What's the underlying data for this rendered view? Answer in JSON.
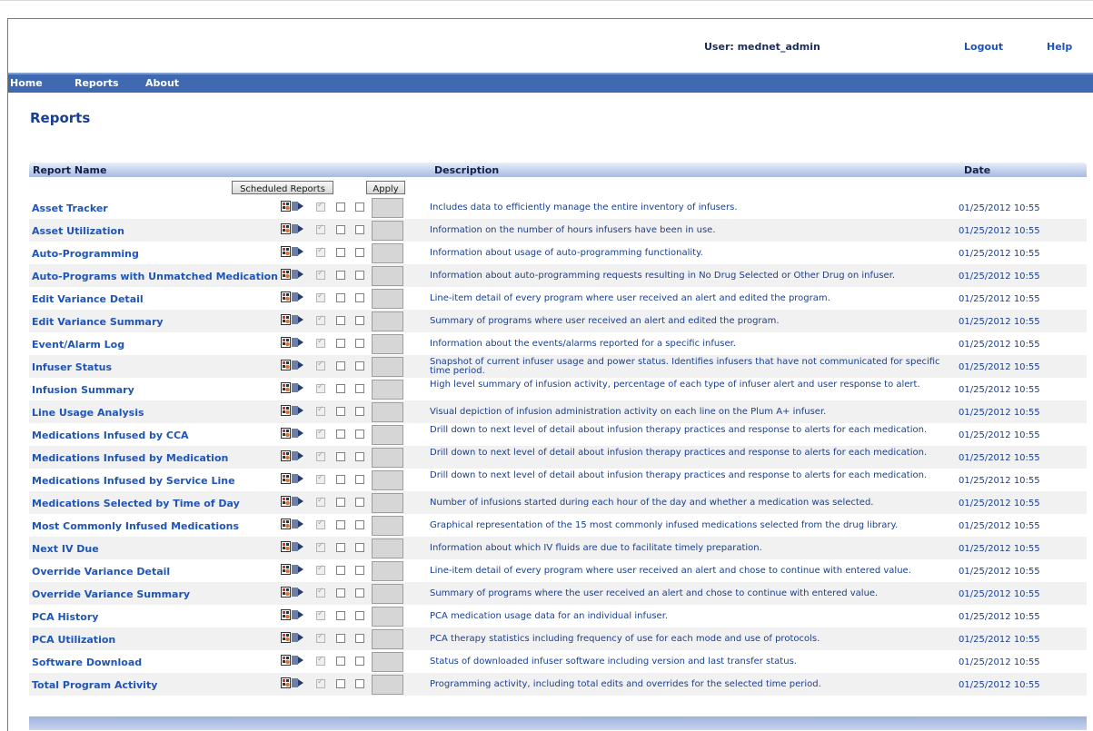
{
  "header": {
    "user_label": "User: mednet_admin",
    "logout": "Logout",
    "help": "Help"
  },
  "nav": {
    "items": [
      "Home",
      "Reports",
      "About"
    ]
  },
  "page": {
    "title": "Reports"
  },
  "table": {
    "columns": {
      "name": "Report Name",
      "description": "Description",
      "date": "Date"
    },
    "scheduled_button": "Scheduled Reports",
    "apply_button": "Apply",
    "rows": [
      {
        "name": "Asset Tracker",
        "description": "Includes data to efficiently manage the entire inventory of infusers.",
        "date": "01/25/2012 10:55"
      },
      {
        "name": "Asset Utilization",
        "description": "Information on the number of hours infusers have been in use.",
        "date": "01/25/2012 10:55"
      },
      {
        "name": "Auto-Programming",
        "description": "Information about usage of auto-programming functionality.",
        "date": "01/25/2012 10:55"
      },
      {
        "name": "Auto-Programs with Unmatched Medication",
        "description": "Information about auto-programming requests resulting in No Drug Selected or Other Drug on infuser.",
        "date": "01/25/2012 10:55"
      },
      {
        "name": "Edit Variance Detail",
        "description": "Line-item detail of every program where user received an alert and edited the program.",
        "date": "01/25/2012 10:55"
      },
      {
        "name": "Edit Variance Summary",
        "description": "Summary of programs where user received an alert and edited the program.",
        "date": "01/25/2012 10:55"
      },
      {
        "name": "Event/Alarm Log",
        "description": "Information about the events/alarms reported for a specific infuser.",
        "date": "01/25/2012 10:55"
      },
      {
        "name": "Infuser Status",
        "description": "Snapshot of current infuser usage and power status. Identifies infusers that have not communicated for specific time period.",
        "date": "01/25/2012 10:55"
      },
      {
        "name": "Infusion Summary",
        "description": "High level summary of infusion activity, percentage of each type of infuser alert and user response to alert.",
        "date": "01/25/2012 10:55"
      },
      {
        "name": "Line Usage Analysis",
        "description": "Visual depiction of infusion administration activity on each line on the Plum A+ infuser.",
        "date": "01/25/2012 10:55"
      },
      {
        "name": "Medications Infused by CCA",
        "description": "Drill down to next level of detail about infusion therapy practices and response to alerts for each medication.",
        "date": "01/25/2012 10:55"
      },
      {
        "name": "Medications Infused by Medication",
        "description": "Drill down to next level of detail about infusion therapy practices and response to alerts for each medication.",
        "date": "01/25/2012 10:55"
      },
      {
        "name": "Medications Infused by Service Line",
        "description": "Drill down to next level of detail about infusion therapy practices and response to alerts for each medication.",
        "date": "01/25/2012 10:55"
      },
      {
        "name": "Medications Selected by Time of Day",
        "description": "Number of infusions started during each hour of the day and whether a medication was selected.",
        "date": "01/25/2012 10:55"
      },
      {
        "name": "Most Commonly Infused Medications",
        "description": "Graphical representation of the 15 most commonly infused medications selected from the drug library.",
        "date": "01/25/2012 10:55"
      },
      {
        "name": "Next IV Due",
        "description": "Information about which IV fluids are due to facilitate timely preparation.",
        "date": "01/25/2012 10:55"
      },
      {
        "name": "Override Variance Detail",
        "description": "Line-item detail of every program where user received an alert and chose to continue with entered value.",
        "date": "01/25/2012 10:55"
      },
      {
        "name": "Override Variance Summary",
        "description": "Summary of programs where the user received an alert and chose to continue with entered value.",
        "date": "01/25/2012 10:55"
      },
      {
        "name": "PCA History",
        "description": "PCA medication usage data for an individual infuser.",
        "date": "01/25/2012 10:55"
      },
      {
        "name": "PCA Utilization",
        "description": "PCA therapy statistics including frequency of use for each mode and use of protocols.",
        "date": "01/25/2012 10:55"
      },
      {
        "name": "Software Download",
        "description": "Status of downloaded infuser software including version and last transfer status.",
        "date": "01/25/2012 10:55"
      },
      {
        "name": "Total Program Activity",
        "description": "Programming activity, including total edits and overrides for the selected time period.",
        "date": "01/25/2012 10:55"
      }
    ]
  }
}
